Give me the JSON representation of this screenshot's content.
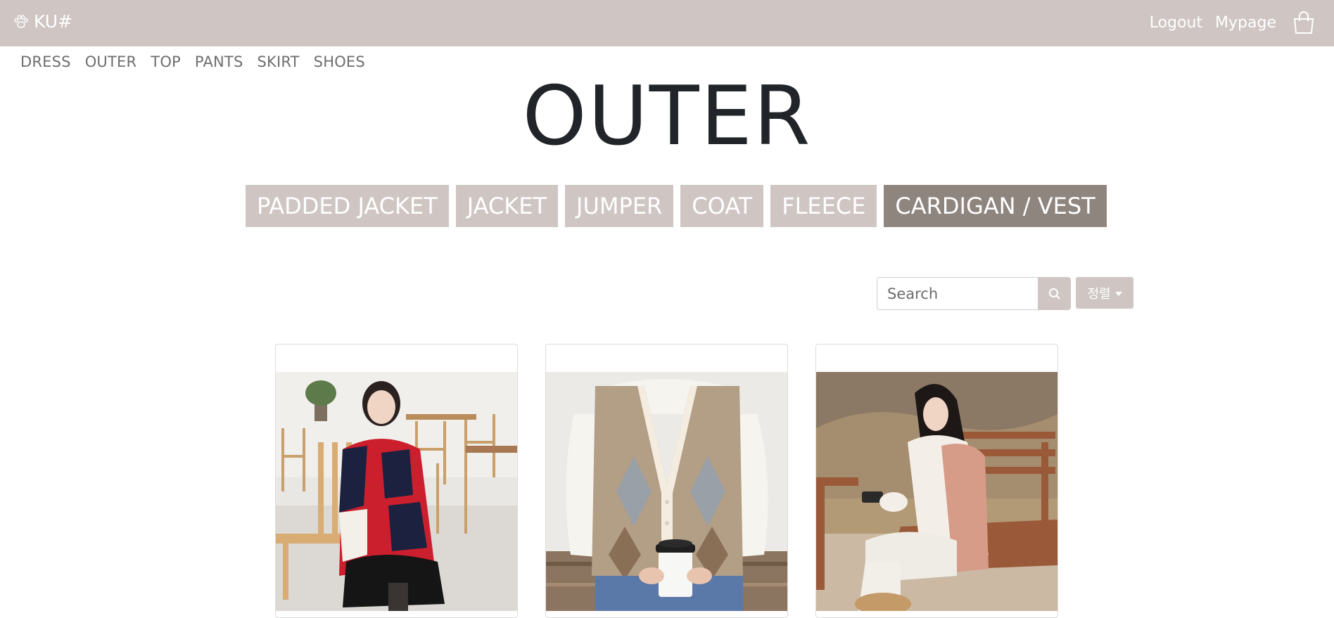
{
  "header": {
    "brand": "KU#",
    "logout": "Logout",
    "mypage": "Mypage",
    "icons": [
      "paw-icon",
      "shopping-bag-icon"
    ]
  },
  "category_nav": [
    "DRESS",
    "OUTER",
    "TOP",
    "PANTS",
    "SKIRT",
    "SHOES"
  ],
  "page_title": "OUTER",
  "sub_tabs": [
    {
      "label": "PADDED JACKET",
      "active": false
    },
    {
      "label": "JACKET",
      "active": false
    },
    {
      "label": "JUMPER",
      "active": false
    },
    {
      "label": "COAT",
      "active": false
    },
    {
      "label": "FLEECE",
      "active": false
    },
    {
      "label": "CARDIGAN / VEST",
      "active": true
    }
  ],
  "search": {
    "placeholder": "Search",
    "value": ""
  },
  "sort": {
    "label": "정렬"
  },
  "products": [
    {
      "image": "woman-red-navy-cardigan-cafe"
    },
    {
      "image": "argyle-knit-vest-with-coffee"
    },
    {
      "image": "woman-pink-padded-vest-bench"
    }
  ],
  "colors": {
    "bar": "#cfc6c3",
    "tab_active": "#8f857f",
    "title": "#212529",
    "nav_text": "#6e6e6e"
  }
}
